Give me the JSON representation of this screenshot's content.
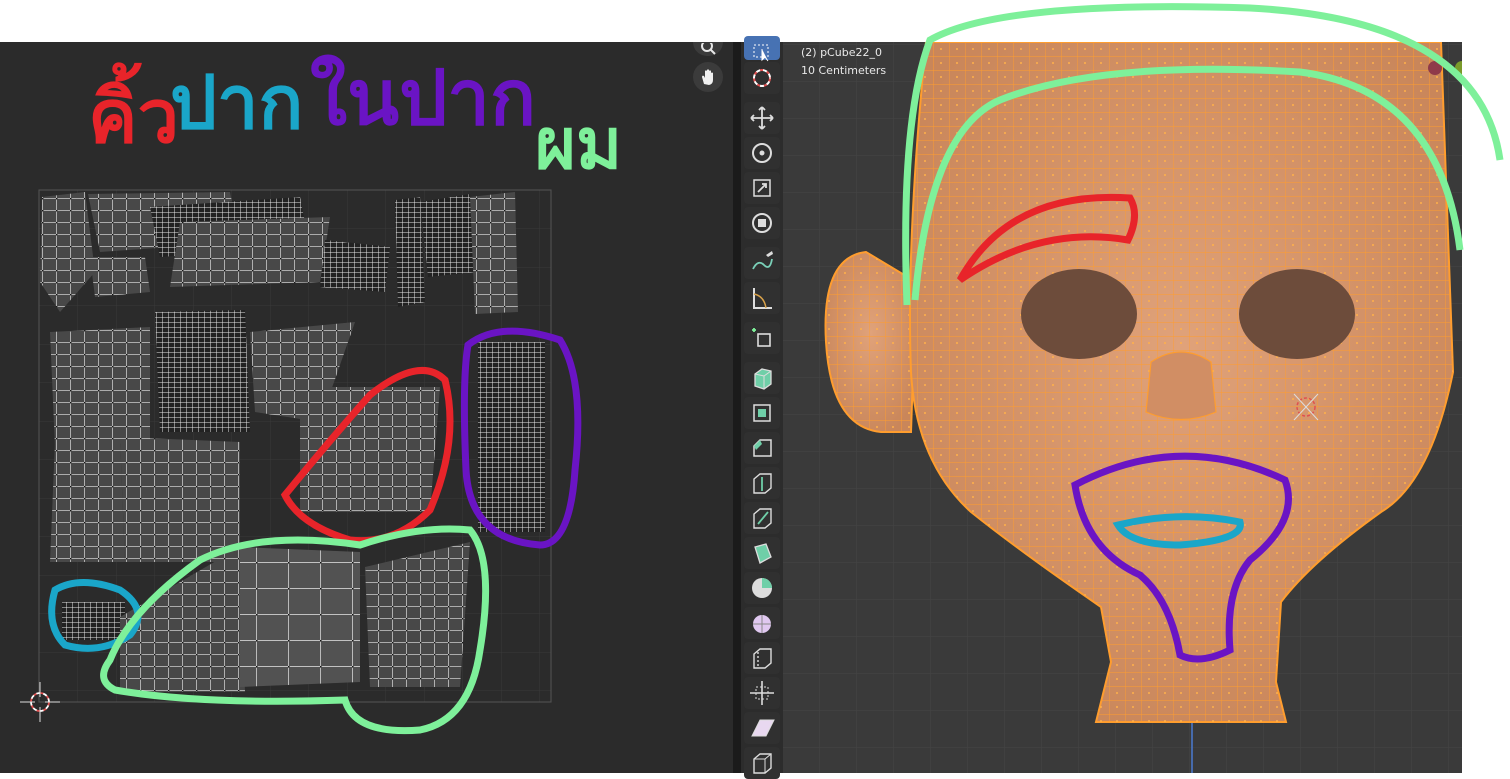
{
  "viewport": {
    "object_info": "(2) pCube22_0",
    "scale_info": "10 Centimeters"
  },
  "annotations": {
    "eyebrow_label": "คิ้ว",
    "lips_label": "ปาก",
    "inner_mouth_label": "ในปาก",
    "hair_label": "ผม",
    "colors": {
      "eyebrow": "#e8242a",
      "lips": "#1aa6c9",
      "inner_mouth": "#6a14c4",
      "hair": "#7ef09a"
    }
  },
  "uv_editor": {
    "icons": [
      "zoom-icon",
      "hand-pan-icon"
    ]
  },
  "toolbar": {
    "tools": [
      "select-box",
      "cursor",
      "move",
      "rotate",
      "scale",
      "transform",
      "annotate",
      "measure",
      "add-cube",
      "extrude-region",
      "inset-faces",
      "bevel",
      "loop-cut",
      "knife",
      "poly-build",
      "spin",
      "smooth",
      "edge-slide",
      "shrink-fatten",
      "shear",
      "rip-region"
    ]
  }
}
